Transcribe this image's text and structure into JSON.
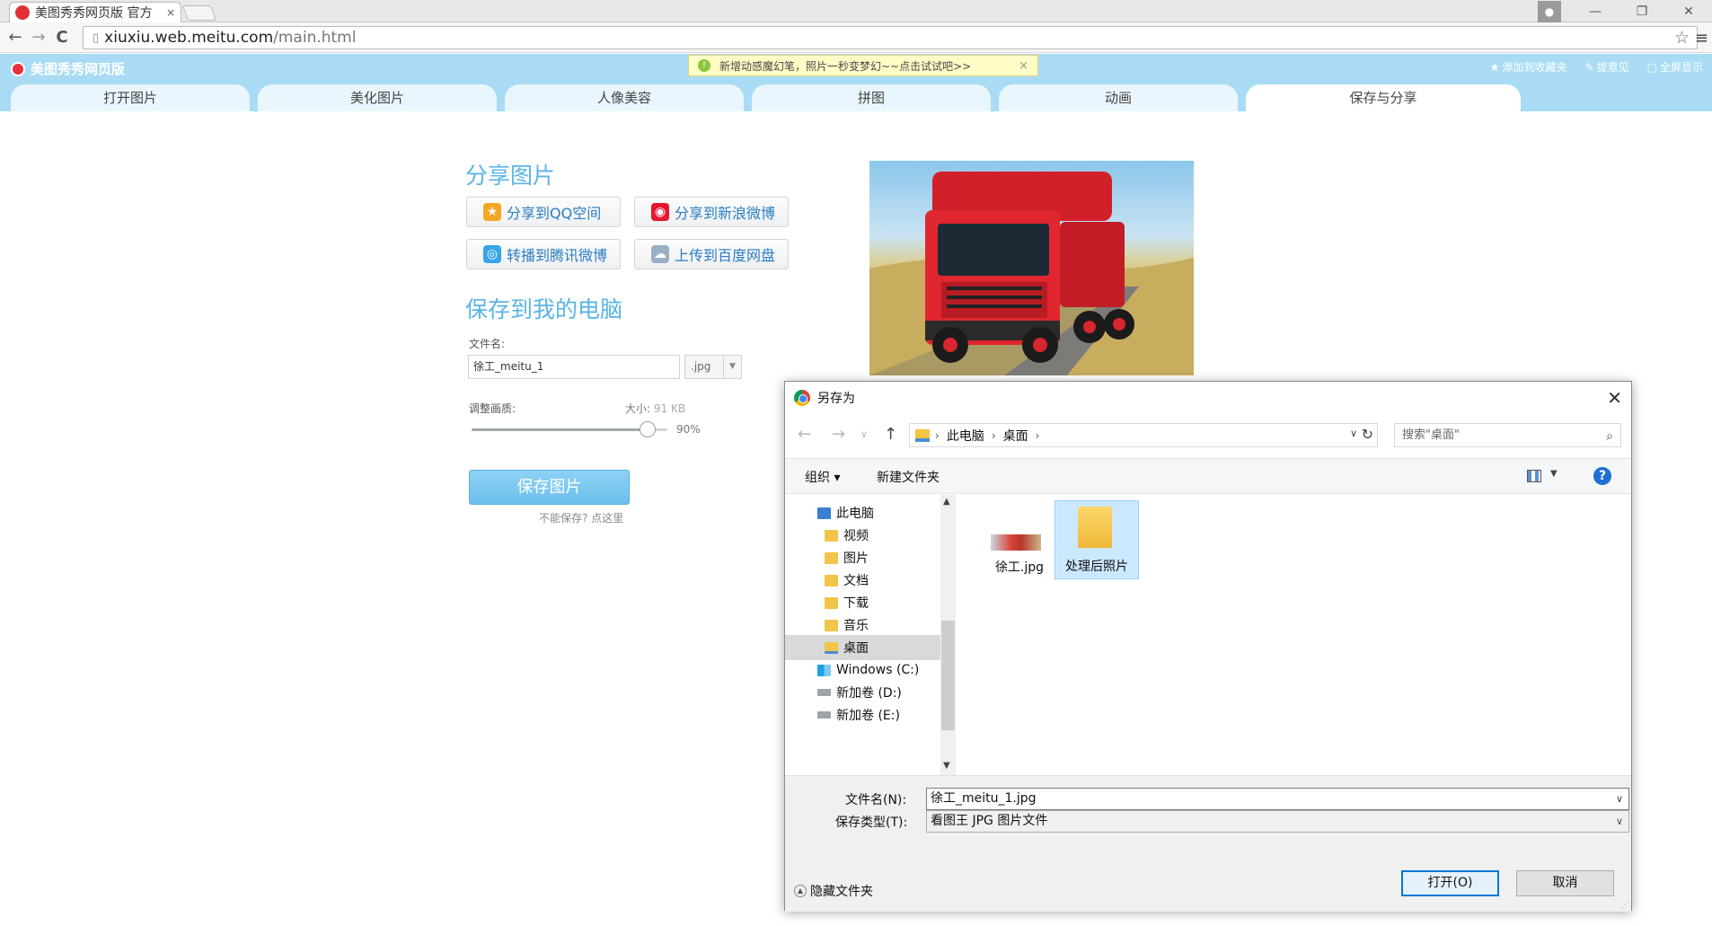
{
  "browser": {
    "tab_title": "美图秀秀网页版 官方",
    "tab_close": "×",
    "url_host": "xiuxiu.web.meitu.com",
    "url_path": "/main.html",
    "back_glyph": "←",
    "forward_glyph": "→",
    "reload_glyph": "C",
    "star_glyph": "☆",
    "menu_glyph": "≡",
    "win_min": "—",
    "win_restore": "❐",
    "win_close": "✕"
  },
  "app": {
    "brand": "美图秀秀网页版",
    "notice": "新增动感魔幻笔，照片一秒变梦幻~~点击试试吧>>",
    "notice_close": "×",
    "links": [
      {
        "icon": "★",
        "label": "添加到收藏夹"
      },
      {
        "icon": "✎",
        "label": "提意见"
      },
      {
        "icon": "▢",
        "label": "全屏显示"
      }
    ],
    "tabs": [
      "打开图片",
      "美化图片",
      "人像美容",
      "拼图",
      "动画",
      "保存与分享"
    ],
    "active_tab": "保存与分享"
  },
  "share": {
    "heading": "分享图片",
    "buttons": [
      {
        "label": "分享到QQ空间",
        "icon": "qzone-icon",
        "color": "#f5a623"
      },
      {
        "label": "分享到新浪微博",
        "icon": "weibo-icon",
        "color": "#e6162d"
      },
      {
        "label": "转播到腾讯微博",
        "icon": "tencent-weibo-icon",
        "color": "#37a5e8"
      },
      {
        "label": "上传到百度网盘",
        "icon": "baidu-pan-icon",
        "color": "#9ab0c6"
      }
    ]
  },
  "save": {
    "heading": "保存到我的电脑",
    "filename_label": "文件名:",
    "filename_value": "徐工_meitu_1",
    "ext_value": ".jpg",
    "quality_label": "调整画质:",
    "size_label": "大小:",
    "size_value": "91 KB",
    "quality_value": "90%",
    "quality_fraction": 0.9,
    "save_button": "保存图片",
    "cant_save": "不能保存? 点这里"
  },
  "dialog": {
    "title": "另存为",
    "close": "✕",
    "breadcrumb": [
      "此电脑",
      "桌面"
    ],
    "search_placeholder": "搜索\"桌面\"",
    "organize": "组织 ▾",
    "new_folder": "新建文件夹",
    "help": "?",
    "tree": [
      {
        "label": "此电脑",
        "icon": "pc-icon"
      },
      {
        "label": "视频",
        "icon": "folder-icon"
      },
      {
        "label": "图片",
        "icon": "folder-icon"
      },
      {
        "label": "文档",
        "icon": "folder-icon"
      },
      {
        "label": "下载",
        "icon": "folder-icon"
      },
      {
        "label": "音乐",
        "icon": "folder-icon"
      },
      {
        "label": "桌面",
        "icon": "folder-icon",
        "selected": true
      },
      {
        "label": "Windows (C:)",
        "icon": "windows-drive-icon"
      },
      {
        "label": "新加卷 (D:)",
        "icon": "drive-icon"
      },
      {
        "label": "新加卷 (E:)",
        "icon": "drive-icon"
      }
    ],
    "files": [
      {
        "label": "徐工.jpg",
        "kind": "image"
      },
      {
        "label": "处理后照片",
        "kind": "folder",
        "selected": true
      }
    ],
    "filename_label": "文件名(N):",
    "filename_value": "徐工_meitu_1.jpg",
    "type_label": "保存类型(T):",
    "type_value": "看图王 JPG 图片文件",
    "hide_folders": "隐藏文件夹",
    "open_button": "打开(O)",
    "cancel_button": "取消"
  }
}
